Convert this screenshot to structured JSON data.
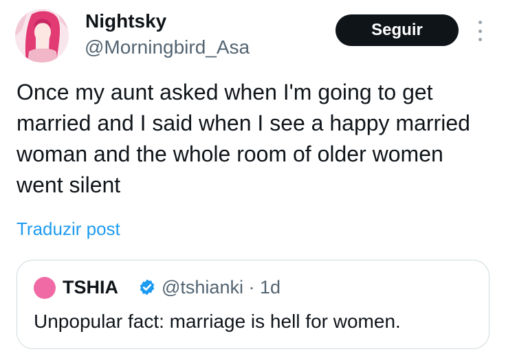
{
  "author": {
    "display_name": "Nightsky",
    "handle": "@Morningbird_Asa"
  },
  "actions": {
    "follow_label": "Seguir",
    "more_icon": "more-vertical-icon"
  },
  "post": {
    "text": "Once my aunt asked when I'm going to get married and I said when I see a happy married woman and the whole room of older women went silent",
    "translate_label": "Traduzir post"
  },
  "quoted_post": {
    "display_name": "TSHIA",
    "verified_icon": "verified-badge-icon",
    "handle": "@tshianki",
    "separator": "·",
    "time": "1d",
    "text": "Unpopular fact: marriage is hell for women.",
    "avatar_color": "#f06ba5"
  },
  "colors": {
    "text": "#0f1419",
    "secondary": "#536471",
    "link": "#1d9bf0",
    "verified": "#1d9bf0",
    "button_bg": "#0f1419"
  }
}
